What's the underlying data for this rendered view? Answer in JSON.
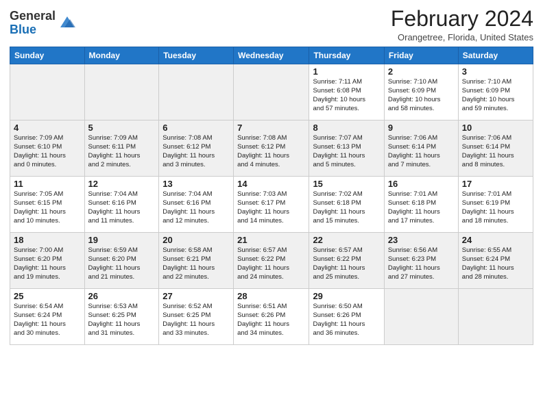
{
  "header": {
    "logo_general": "General",
    "logo_blue": "Blue",
    "month_title": "February 2024",
    "location": "Orangetree, Florida, United States"
  },
  "weekdays": [
    "Sunday",
    "Monday",
    "Tuesday",
    "Wednesday",
    "Thursday",
    "Friday",
    "Saturday"
  ],
  "weeks": [
    [
      {
        "day": "",
        "info": ""
      },
      {
        "day": "",
        "info": ""
      },
      {
        "day": "",
        "info": ""
      },
      {
        "day": "",
        "info": ""
      },
      {
        "day": "1",
        "info": "Sunrise: 7:11 AM\nSunset: 6:08 PM\nDaylight: 10 hours\nand 57 minutes."
      },
      {
        "day": "2",
        "info": "Sunrise: 7:10 AM\nSunset: 6:09 PM\nDaylight: 10 hours\nand 58 minutes."
      },
      {
        "day": "3",
        "info": "Sunrise: 7:10 AM\nSunset: 6:09 PM\nDaylight: 10 hours\nand 59 minutes."
      }
    ],
    [
      {
        "day": "4",
        "info": "Sunrise: 7:09 AM\nSunset: 6:10 PM\nDaylight: 11 hours\nand 0 minutes."
      },
      {
        "day": "5",
        "info": "Sunrise: 7:09 AM\nSunset: 6:11 PM\nDaylight: 11 hours\nand 2 minutes."
      },
      {
        "day": "6",
        "info": "Sunrise: 7:08 AM\nSunset: 6:12 PM\nDaylight: 11 hours\nand 3 minutes."
      },
      {
        "day": "7",
        "info": "Sunrise: 7:08 AM\nSunset: 6:12 PM\nDaylight: 11 hours\nand 4 minutes."
      },
      {
        "day": "8",
        "info": "Sunrise: 7:07 AM\nSunset: 6:13 PM\nDaylight: 11 hours\nand 5 minutes."
      },
      {
        "day": "9",
        "info": "Sunrise: 7:06 AM\nSunset: 6:14 PM\nDaylight: 11 hours\nand 7 minutes."
      },
      {
        "day": "10",
        "info": "Sunrise: 7:06 AM\nSunset: 6:14 PM\nDaylight: 11 hours\nand 8 minutes."
      }
    ],
    [
      {
        "day": "11",
        "info": "Sunrise: 7:05 AM\nSunset: 6:15 PM\nDaylight: 11 hours\nand 10 minutes."
      },
      {
        "day": "12",
        "info": "Sunrise: 7:04 AM\nSunset: 6:16 PM\nDaylight: 11 hours\nand 11 minutes."
      },
      {
        "day": "13",
        "info": "Sunrise: 7:04 AM\nSunset: 6:16 PM\nDaylight: 11 hours\nand 12 minutes."
      },
      {
        "day": "14",
        "info": "Sunrise: 7:03 AM\nSunset: 6:17 PM\nDaylight: 11 hours\nand 14 minutes."
      },
      {
        "day": "15",
        "info": "Sunrise: 7:02 AM\nSunset: 6:18 PM\nDaylight: 11 hours\nand 15 minutes."
      },
      {
        "day": "16",
        "info": "Sunrise: 7:01 AM\nSunset: 6:18 PM\nDaylight: 11 hours\nand 17 minutes."
      },
      {
        "day": "17",
        "info": "Sunrise: 7:01 AM\nSunset: 6:19 PM\nDaylight: 11 hours\nand 18 minutes."
      }
    ],
    [
      {
        "day": "18",
        "info": "Sunrise: 7:00 AM\nSunset: 6:20 PM\nDaylight: 11 hours\nand 19 minutes."
      },
      {
        "day": "19",
        "info": "Sunrise: 6:59 AM\nSunset: 6:20 PM\nDaylight: 11 hours\nand 21 minutes."
      },
      {
        "day": "20",
        "info": "Sunrise: 6:58 AM\nSunset: 6:21 PM\nDaylight: 11 hours\nand 22 minutes."
      },
      {
        "day": "21",
        "info": "Sunrise: 6:57 AM\nSunset: 6:22 PM\nDaylight: 11 hours\nand 24 minutes."
      },
      {
        "day": "22",
        "info": "Sunrise: 6:57 AM\nSunset: 6:22 PM\nDaylight: 11 hours\nand 25 minutes."
      },
      {
        "day": "23",
        "info": "Sunrise: 6:56 AM\nSunset: 6:23 PM\nDaylight: 11 hours\nand 27 minutes."
      },
      {
        "day": "24",
        "info": "Sunrise: 6:55 AM\nSunset: 6:24 PM\nDaylight: 11 hours\nand 28 minutes."
      }
    ],
    [
      {
        "day": "25",
        "info": "Sunrise: 6:54 AM\nSunset: 6:24 PM\nDaylight: 11 hours\nand 30 minutes."
      },
      {
        "day": "26",
        "info": "Sunrise: 6:53 AM\nSunset: 6:25 PM\nDaylight: 11 hours\nand 31 minutes."
      },
      {
        "day": "27",
        "info": "Sunrise: 6:52 AM\nSunset: 6:25 PM\nDaylight: 11 hours\nand 33 minutes."
      },
      {
        "day": "28",
        "info": "Sunrise: 6:51 AM\nSunset: 6:26 PM\nDaylight: 11 hours\nand 34 minutes."
      },
      {
        "day": "29",
        "info": "Sunrise: 6:50 AM\nSunset: 6:26 PM\nDaylight: 11 hours\nand 36 minutes."
      },
      {
        "day": "",
        "info": ""
      },
      {
        "day": "",
        "info": ""
      }
    ]
  ]
}
